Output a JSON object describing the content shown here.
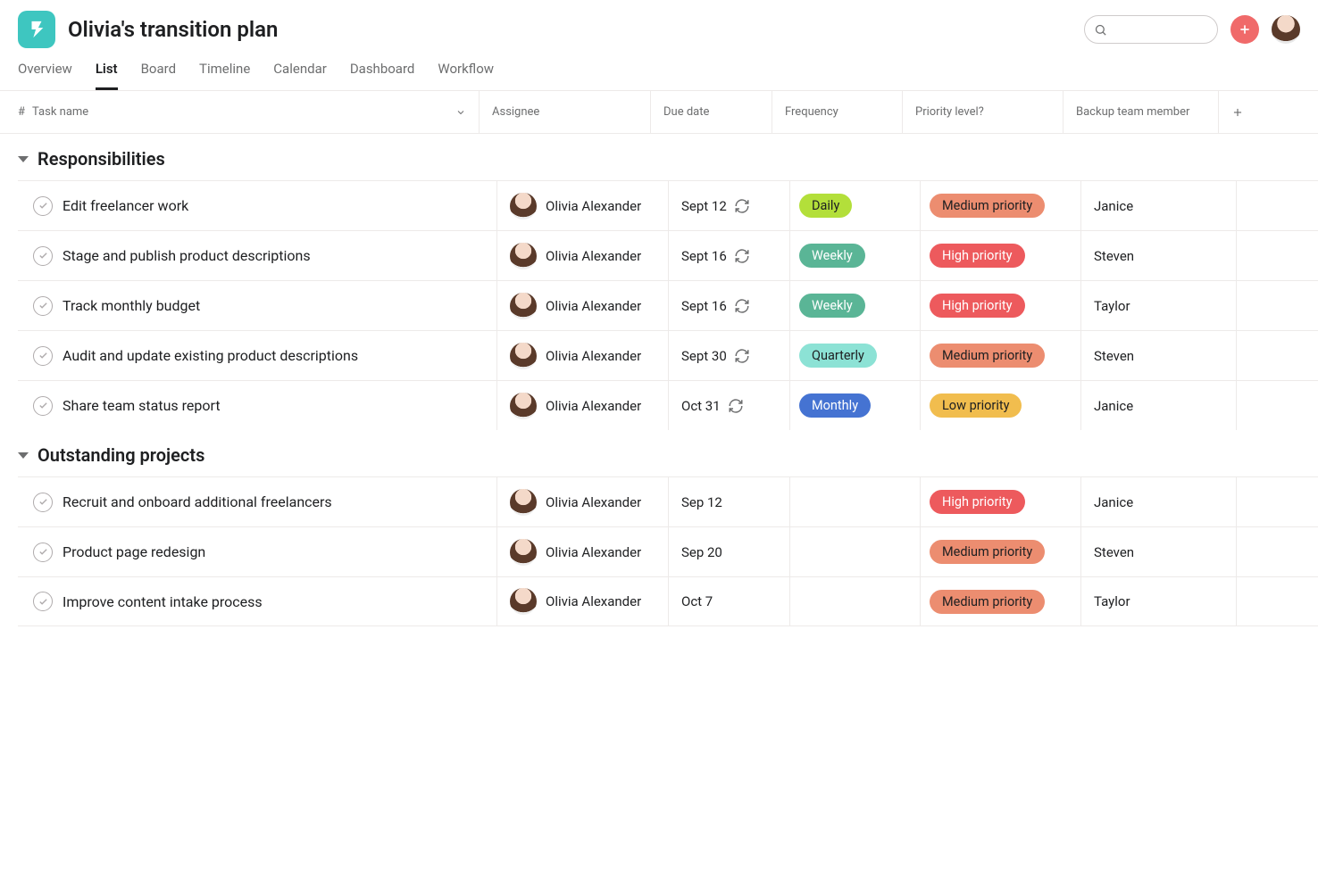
{
  "project": {
    "title": "Olivia's transition plan"
  },
  "tabs": [
    {
      "label": "Overview"
    },
    {
      "label": "List"
    },
    {
      "label": "Board"
    },
    {
      "label": "Timeline"
    },
    {
      "label": "Calendar"
    },
    {
      "label": "Dashboard"
    },
    {
      "label": "Workflow"
    }
  ],
  "columns": {
    "hash": "#",
    "task": "Task name",
    "assignee": "Assignee",
    "due": "Due date",
    "freq": "Frequency",
    "priority": "Priority level?",
    "backup": "Backup team member"
  },
  "frequency_colors": {
    "Daily": {
      "bg": "#b3df3a",
      "fg": "#1e1f21"
    },
    "Weekly": {
      "bg": "#5ab596",
      "fg": "#ffffff"
    },
    "Quarterly": {
      "bg": "#8ce2d5",
      "fg": "#1e1f21"
    },
    "Monthly": {
      "bg": "#4573d2",
      "fg": "#ffffff"
    }
  },
  "priority_colors": {
    "High priority": {
      "bg": "#ed5a5d",
      "fg": "#ffffff"
    },
    "Medium priority": {
      "bg": "#ec8d70",
      "fg": "#1e1f21"
    },
    "Low priority": {
      "bg": "#f1bd4e",
      "fg": "#1e1f21"
    }
  },
  "sections": [
    {
      "title": "Responsibilities",
      "tasks": [
        {
          "name": "Edit freelancer work",
          "assignee": "Olivia Alexander",
          "due": "Sept 12",
          "recurring": true,
          "frequency": "Daily",
          "priority": "Medium priority",
          "backup": "Janice"
        },
        {
          "name": "Stage and publish product descriptions",
          "assignee": "Olivia Alexander",
          "due": "Sept 16",
          "recurring": true,
          "frequency": "Weekly",
          "priority": "High priority",
          "backup": "Steven"
        },
        {
          "name": "Track monthly budget",
          "assignee": "Olivia Alexander",
          "due": "Sept 16",
          "recurring": true,
          "frequency": "Weekly",
          "priority": "High priority",
          "backup": "Taylor"
        },
        {
          "name": "Audit and update existing product descriptions",
          "assignee": "Olivia Alexander",
          "due": "Sept 30",
          "recurring": true,
          "frequency": "Quarterly",
          "priority": "Medium priority",
          "backup": "Steven"
        },
        {
          "name": "Share team status report",
          "assignee": "Olivia Alexander",
          "due": "Oct 31",
          "recurring": true,
          "frequency": "Monthly",
          "priority": "Low priority",
          "backup": "Janice"
        }
      ]
    },
    {
      "title": "Outstanding projects",
      "tasks": [
        {
          "name": "Recruit and onboard additional freelancers",
          "assignee": "Olivia Alexander",
          "due": "Sep 12",
          "recurring": false,
          "frequency": "",
          "priority": "High priority",
          "backup": "Janice"
        },
        {
          "name": "Product page redesign",
          "assignee": "Olivia Alexander",
          "due": "Sep 20",
          "recurring": false,
          "frequency": "",
          "priority": "Medium priority",
          "backup": "Steven"
        },
        {
          "name": "Improve content intake process",
          "assignee": "Olivia Alexander",
          "due": "Oct 7",
          "recurring": false,
          "frequency": "",
          "priority": "Medium priority",
          "backup": "Taylor"
        }
      ]
    }
  ]
}
